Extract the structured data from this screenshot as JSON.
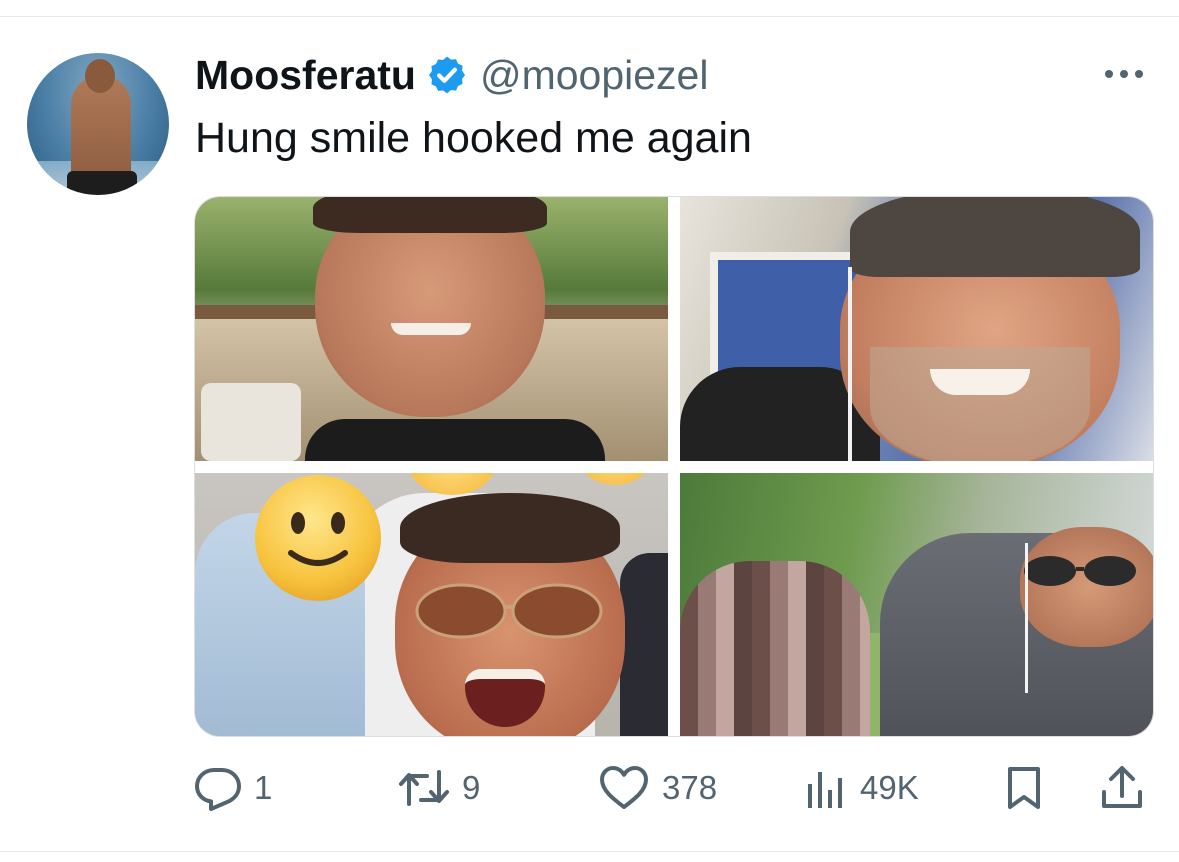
{
  "tweet": {
    "display_name": "Moosferatu",
    "handle": "@moopiezel",
    "text": "Hung smile hooked me again",
    "verified": true,
    "avatar_icon": "profile-photo",
    "more_icon": "more-horizontal-icon",
    "media": [
      {
        "name": "photo-1"
      },
      {
        "name": "photo-2"
      },
      {
        "name": "photo-3"
      },
      {
        "name": "photo-4"
      }
    ]
  },
  "actions": {
    "reply": {
      "icon": "reply-icon",
      "count": "1"
    },
    "retweet": {
      "icon": "retweet-icon",
      "count": "9"
    },
    "like": {
      "icon": "heart-icon",
      "count": "378"
    },
    "views": {
      "icon": "analytics-icon",
      "count": "49K"
    },
    "bookmark": {
      "icon": "bookmark-icon"
    },
    "share": {
      "icon": "share-icon"
    }
  },
  "colors": {
    "text_primary": "#0f1419",
    "text_secondary": "#536471",
    "verified_blue": "#1d9bf0",
    "divider": "#e6e8eb"
  }
}
